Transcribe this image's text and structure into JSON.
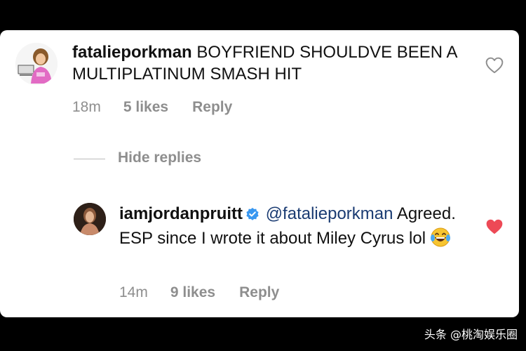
{
  "comment1": {
    "username": "fatalieporkman",
    "text": "BOYFRIEND SHOULDVE BEEN A MULTIPLATINUM SMASH HIT",
    "time": "18m",
    "likes": "5 likes",
    "reply": "Reply",
    "liked": false,
    "heart_color": "#8e8e8e"
  },
  "hide_replies": "Hide replies",
  "comment2": {
    "username": "iamjordanpruitt",
    "verified": true,
    "mention": "@fatalieporkman",
    "text": "Agreed. ESP since I wrote it about Miley Cyrus lol",
    "emoji": "face-with-tears-of-joy",
    "time": "14m",
    "likes": "9 likes",
    "reply": "Reply",
    "liked": true,
    "heart_color": "#ed4956"
  },
  "watermark": "头条 @桃淘娱乐圈",
  "colors": {
    "background": "#000000",
    "card": "#ffffff",
    "meta_text": "#8e8e8e",
    "mention": "#1a3b72",
    "verified_badge": "#3897f0"
  }
}
